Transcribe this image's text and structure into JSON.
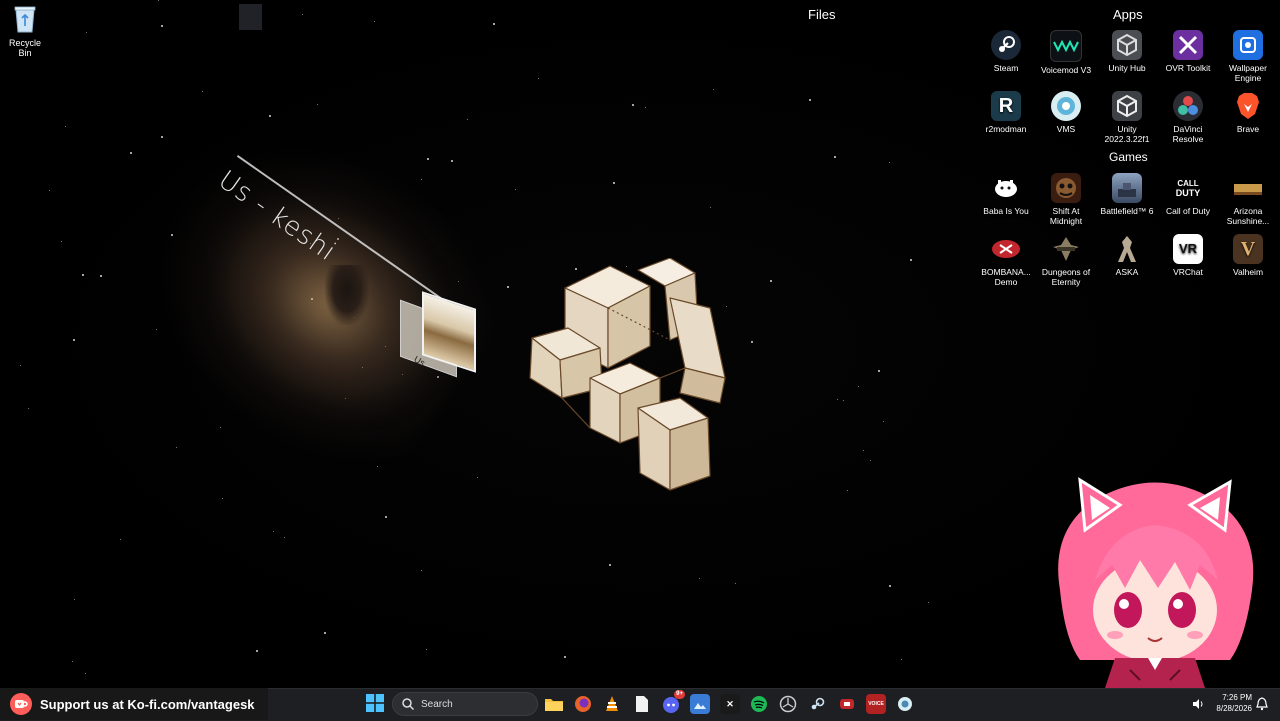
{
  "desktop": {
    "recycle_bin": {
      "label": "Recycle Bin",
      "icon": "recycle-bin-icon"
    },
    "widget": {
      "song_title": "Us - keshi",
      "album_label": "Us"
    }
  },
  "groups": {
    "files": {
      "title": "Files"
    },
    "apps": {
      "title": "Apps",
      "items": [
        {
          "label": "Steam",
          "icon": "steam-icon"
        },
        {
          "label": "Voicemod V3",
          "icon": "voicemod-icon"
        },
        {
          "label": "Unity Hub",
          "icon": "unity-hub-icon"
        },
        {
          "label": "OVR Toolkit",
          "icon": "ovr-toolkit-icon"
        },
        {
          "label": "Wallpaper Engine",
          "icon": "wallpaper-engine-icon"
        },
        {
          "label": "r2modman",
          "icon": "r2modman-icon"
        },
        {
          "label": "VMS",
          "icon": "vms-icon"
        },
        {
          "label": "Unity 2022.3.22f1",
          "icon": "unity-icon"
        },
        {
          "label": "DaVinci Resolve",
          "icon": "davinci-resolve-icon"
        },
        {
          "label": "Brave",
          "icon": "brave-icon"
        }
      ]
    },
    "games": {
      "title": "Games",
      "items": [
        {
          "label": "Baba Is You",
          "icon": "baba-is-you-icon"
        },
        {
          "label": "Shift At Midnight",
          "icon": "shift-at-midnight-icon"
        },
        {
          "label": "Battlefield™ 6",
          "icon": "battlefield-6-icon"
        },
        {
          "label": "Call of Duty",
          "icon": "call-of-duty-icon"
        },
        {
          "label": "Arizona Sunshine...",
          "icon": "arizona-sunshine-icon"
        },
        {
          "label": "BOMBANA... Demo",
          "icon": "bombana-demo-icon"
        },
        {
          "label": "Dungeons of Eternity",
          "icon": "dungeons-of-eternity-icon"
        },
        {
          "label": "ASKA",
          "icon": "aska-icon"
        },
        {
          "label": "VRChat",
          "icon": "vrchat-icon"
        },
        {
          "label": "Valheim",
          "icon": "valheim-icon"
        }
      ]
    }
  },
  "kofi_banner": {
    "text": "Support us at Ko-fi.com/vantagesk"
  },
  "taskbar": {
    "search_placeholder": "Search",
    "apps": [
      {
        "name": "file-explorer",
        "glyph": "",
        "color": "#e8b43a"
      },
      {
        "name": "firefox",
        "glyph": "",
        "color": "#e8632b"
      },
      {
        "name": "vlc",
        "glyph": "",
        "color": "#f08c00"
      },
      {
        "name": "notepad",
        "glyph": "",
        "color": "#f2f2f2"
      },
      {
        "name": "discord",
        "glyph": "",
        "color": "#5865f2",
        "badge": "9+"
      },
      {
        "name": "photos",
        "glyph": "",
        "color": "#3a7bd5"
      },
      {
        "name": "capcut",
        "glyph": "✕",
        "color": "#1a1a1a"
      },
      {
        "name": "spotify",
        "glyph": "",
        "color": "#1db954"
      },
      {
        "name": "unity",
        "glyph": "",
        "color": "#2b2b2b"
      },
      {
        "name": "steam",
        "glyph": "",
        "color": "#1b2838"
      },
      {
        "name": "rec-room",
        "glyph": "",
        "color": "#c0282d"
      },
      {
        "name": "voicemeeter",
        "glyph": "VOICE",
        "color": "#b22222"
      },
      {
        "name": "vms",
        "glyph": "",
        "color": "#4a8ab0"
      }
    ],
    "clock": {
      "time": "7:26 PM",
      "date": "8/28/2026"
    }
  },
  "colors": {
    "taskbar_bg": "#1d1f22",
    "kofi_red": "#ff5e5b",
    "accent_pink": "#ff5f9e"
  }
}
